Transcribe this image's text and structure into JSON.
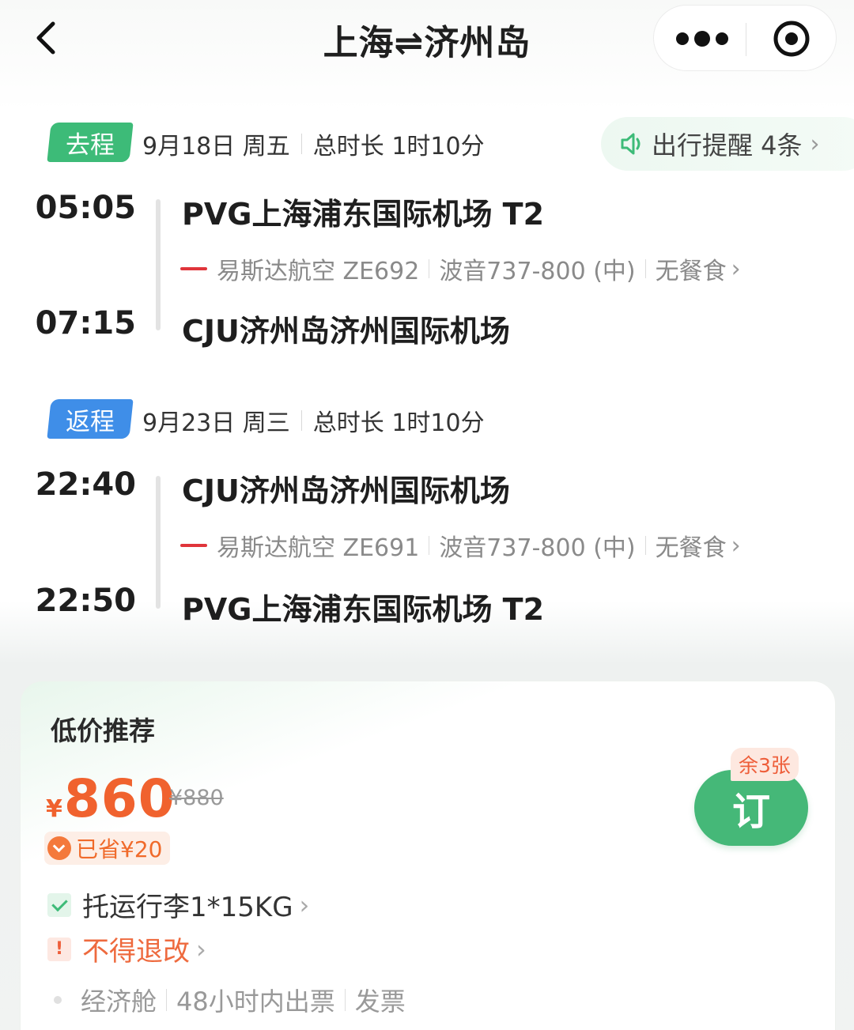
{
  "header": {
    "title": "上海⇌济州岛",
    "back_icon": "chevron-left-icon",
    "more_icon": "more-dots-icon",
    "close_icon": "target-circle-icon"
  },
  "outbound": {
    "tag": "去程",
    "date": "9月18日 周五",
    "duration": "总时长 1时10分",
    "reminder": "出行提醒 4条",
    "depart_time": "05:05",
    "depart_airport": "PVG上海浦东国际机场 T2",
    "airline_flight": "易斯达航空 ZE692",
    "aircraft": "波音737-800 (中)",
    "meal": "无餐食",
    "arrive_time": "07:15",
    "arrive_airport": "CJU济州岛济州国际机场"
  },
  "return": {
    "tag": "返程",
    "date": "9月23日 周三",
    "duration": "总时长 1时10分",
    "depart_time": "22:40",
    "depart_airport": "CJU济州岛济州国际机场",
    "airline_flight": "易斯达航空 ZE691",
    "aircraft": "波音737-800 (中)",
    "meal": "无餐食",
    "arrive_time": "22:50",
    "arrive_airport": "PVG上海浦东国际机场 T2"
  },
  "offer": {
    "title": "低价推荐",
    "currency": "¥",
    "price": "860",
    "original_price": "¥880",
    "saved": "已省¥20",
    "remaining": "余3张",
    "book_label": "订",
    "baggage": "托运行李1*15KG",
    "refund": "不得退改",
    "refund_mark": "!",
    "cabin": "经济舱",
    "issue_time": "48小时内出票",
    "invoice": "发票"
  },
  "colors": {
    "go_tag": "#3dbb78",
    "return_tag": "#3f8ee8",
    "price": "#f0622e",
    "book_button": "#45b878",
    "refund_text": "#ee5e3a"
  }
}
